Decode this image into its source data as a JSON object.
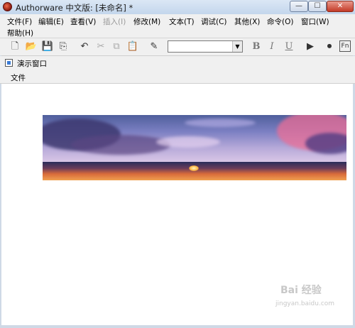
{
  "window": {
    "title": "Authorware 中文版: [未命名] *",
    "minimize_icon": "minimize-icon",
    "maximize_icon": "maximize-icon",
    "close_icon": "close-icon"
  },
  "menu": {
    "items": [
      "文件(F)",
      "编辑(E)",
      "查看(V)",
      "插入(I)",
      "修改(M)",
      "文本(T)",
      "调试(C)",
      "其他(X)",
      "命令(O)",
      "窗口(W)",
      "帮助(H)"
    ],
    "disabled": [
      "插入(I)"
    ]
  },
  "toolbar": {
    "icons": [
      "new-file-icon",
      "open-folder-icon",
      "save-all-icon",
      "import-icon",
      "undo-icon",
      "cut-icon",
      "copy-icon",
      "paste-icon",
      "find-icon",
      "font-combo",
      "bold-icon",
      "italic-icon",
      "underline-icon",
      "run-icon",
      "control-panel-icon",
      "functions-icon"
    ],
    "bold": "B",
    "italic": "I",
    "underline": "U",
    "font_value": ""
  },
  "presentation": {
    "title": "演示窗口",
    "menu_file": "文件"
  },
  "watermark": {
    "text": "Bai 经验",
    "sub": "jingyan.baidu.com"
  }
}
